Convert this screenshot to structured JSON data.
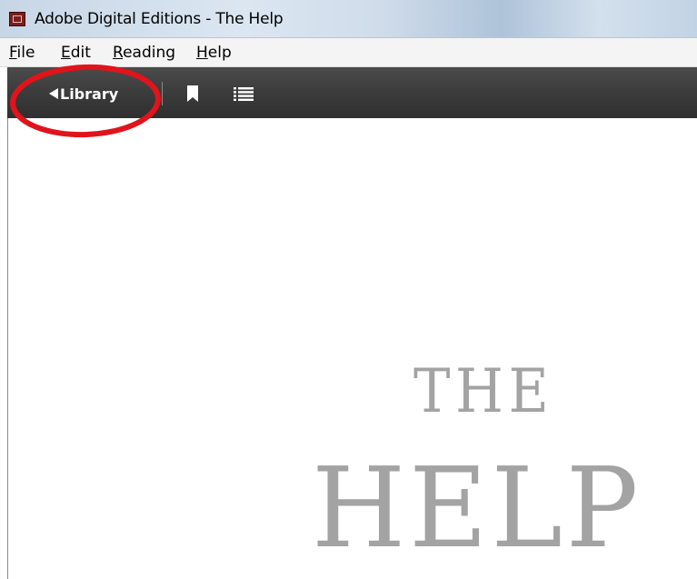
{
  "window": {
    "title": "Adobe Digital Editions - The Help",
    "icon": "adobe-digital-editions-icon"
  },
  "menubar": {
    "items": [
      {
        "mnemonic": "F",
        "rest": "ile"
      },
      {
        "mnemonic": "E",
        "rest": "dit"
      },
      {
        "mnemonic": "R",
        "rest": "eading"
      },
      {
        "mnemonic": "H",
        "rest": "elp"
      }
    ]
  },
  "toolbar": {
    "library_label": "Library",
    "library_icon": "back-arrow-icon",
    "bookmark_icon": "bookmark-icon",
    "toc_icon": "table-of-contents-icon"
  },
  "annotation": {
    "shape": "ellipse",
    "color": "#e0141a",
    "target": "library-button"
  },
  "book": {
    "title_line1": "THE",
    "title_line2": "HELP",
    "text_color": "#a3a3a3"
  }
}
